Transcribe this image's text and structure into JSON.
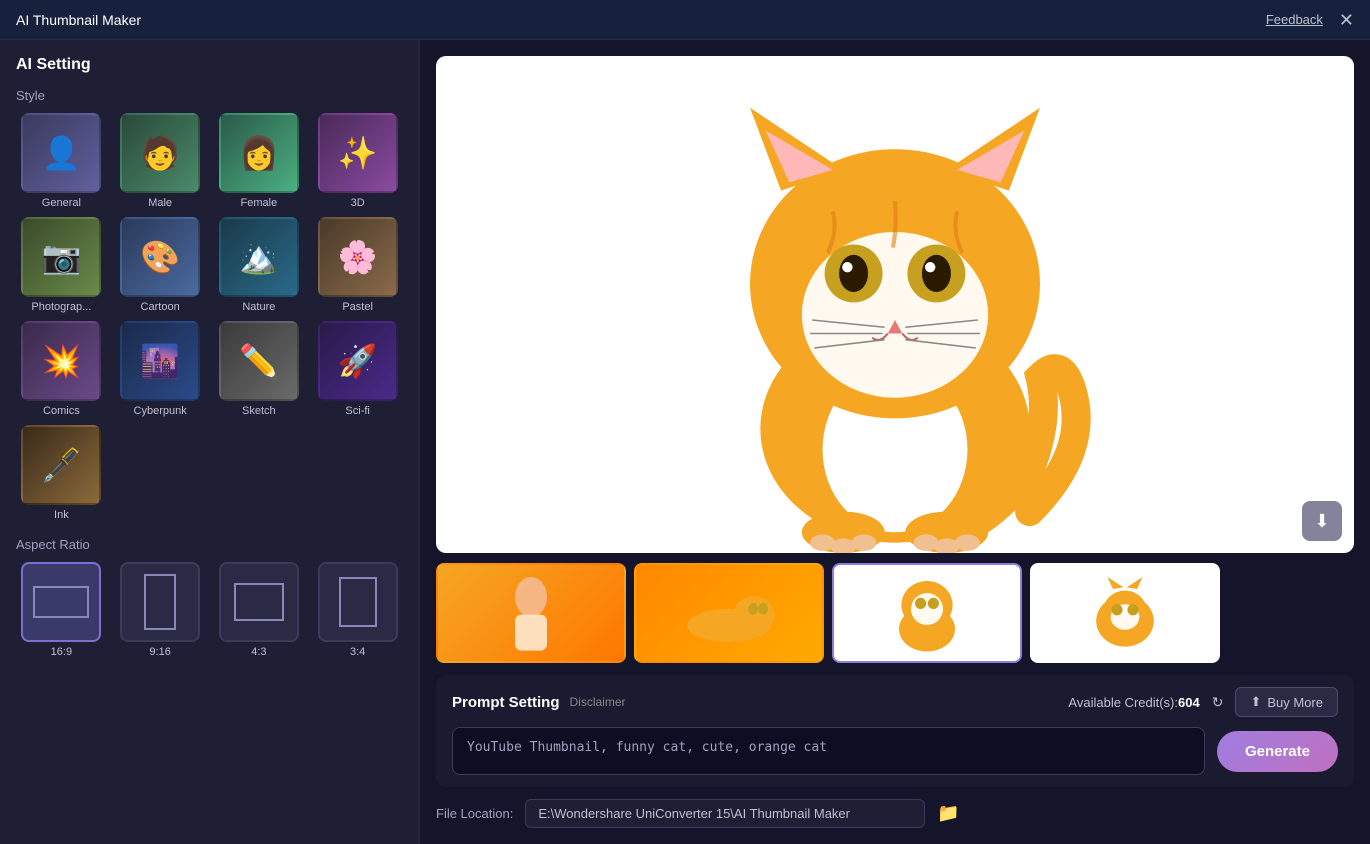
{
  "titleBar": {
    "title": "AI Thumbnail Maker",
    "feedbackLabel": "Feedback",
    "closeSymbol": "✕"
  },
  "leftPanel": {
    "aiSettingTitle": "AI Setting",
    "styleSectionLabel": "Style",
    "styles": [
      {
        "id": "general",
        "label": "General",
        "thumbClass": "thumb-general",
        "emoji": "👤"
      },
      {
        "id": "male",
        "label": "Male",
        "thumbClass": "thumb-male",
        "emoji": "🧑"
      },
      {
        "id": "female",
        "label": "Female",
        "thumbClass": "thumb-female",
        "emoji": "👩"
      },
      {
        "id": "3d",
        "label": "3D",
        "thumbClass": "thumb-3d",
        "emoji": "✨"
      },
      {
        "id": "photography",
        "label": "Photograp...",
        "thumbClass": "thumb-photography",
        "emoji": "📷"
      },
      {
        "id": "cartoon",
        "label": "Cartoon",
        "thumbClass": "thumb-cartoon",
        "emoji": "🎨"
      },
      {
        "id": "nature",
        "label": "Nature",
        "thumbClass": "thumb-nature",
        "emoji": "🏔️"
      },
      {
        "id": "pastel",
        "label": "Pastel",
        "thumbClass": "thumb-pastel",
        "emoji": "🌸"
      },
      {
        "id": "comics",
        "label": "Comics",
        "thumbClass": "thumb-comics",
        "emoji": "💥"
      },
      {
        "id": "cyberpunk",
        "label": "Cyberpunk",
        "thumbClass": "thumb-cyberpunk",
        "emoji": "🌆"
      },
      {
        "id": "sketch",
        "label": "Sketch",
        "thumbClass": "thumb-sketch",
        "emoji": "✏️"
      },
      {
        "id": "scifi",
        "label": "Sci-fi",
        "thumbClass": "thumb-scifi",
        "emoji": "🚀"
      },
      {
        "id": "ink",
        "label": "Ink",
        "thumbClass": "thumb-ink",
        "emoji": "🖋️"
      }
    ],
    "aspectRatioLabel": "Aspect Ratio",
    "aspectRatios": [
      {
        "id": "16:9",
        "label": "16:9",
        "w": 56,
        "h": 32,
        "selected": true
      },
      {
        "id": "9:16",
        "label": "9:16",
        "w": 32,
        "h": 56,
        "selected": false
      },
      {
        "id": "4:3",
        "label": "4:3",
        "w": 50,
        "h": 38,
        "selected": false
      },
      {
        "id": "3:4",
        "label": "3:4",
        "w": 38,
        "h": 50,
        "selected": false
      }
    ]
  },
  "rightPanel": {
    "downloadIconSymbol": "⬇",
    "promptSection": {
      "title": "Prompt Setting",
      "disclaimerLabel": "Disclaimer",
      "creditsLabel": "Available Credit(s):",
      "creditsValue": "604",
      "refreshSymbol": "↻",
      "buyMoreLabel": "Buy More",
      "buyMoreIcon": "⬆",
      "promptPlaceholder": "YouTube Thumbnail, funny cat, cute, orange cat",
      "promptValue": "YouTube Thumbnail, funny cat, cute, orange cat",
      "generateLabel": "Generate"
    },
    "fileLocation": {
      "label": "File Location:",
      "path": "E:\\Wondershare UniConverter 15\\AI Thumbnail Maker",
      "folderIconSymbol": "📁"
    }
  }
}
